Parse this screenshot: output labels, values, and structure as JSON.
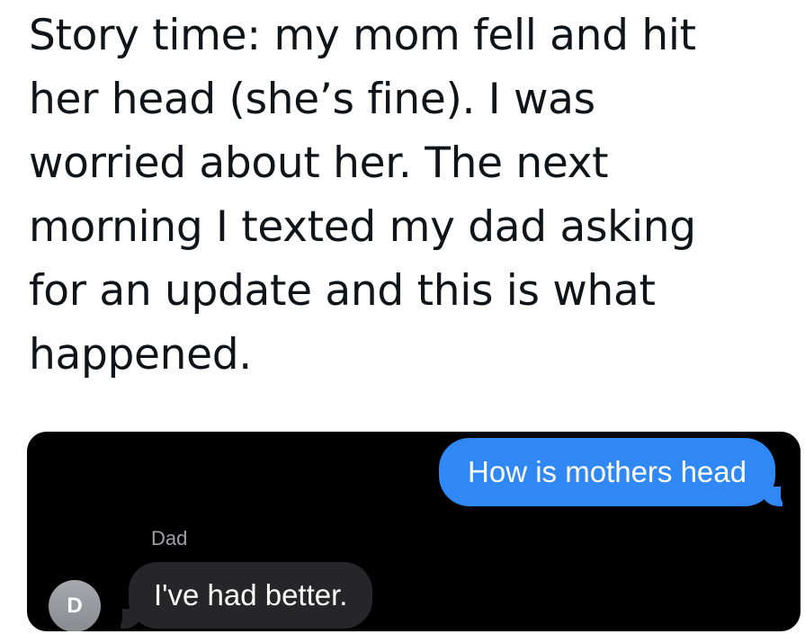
{
  "tweet": {
    "lines": [
      "Story time: my mom fell and hit",
      "her head (she’s fine). I was",
      "worried about her. The next",
      "morning I texted my dad asking",
      "for an update and this is what",
      "happened."
    ]
  },
  "conversation": {
    "sent_message": "How is mothers head",
    "sender_name": "Dad",
    "avatar_initial": "D",
    "received_message": "I've had better."
  },
  "colors": {
    "sent_bubble": "#2f88f4",
    "received_bubble": "#262628",
    "chat_background": "#000000",
    "avatar": "#9a9ba0"
  }
}
